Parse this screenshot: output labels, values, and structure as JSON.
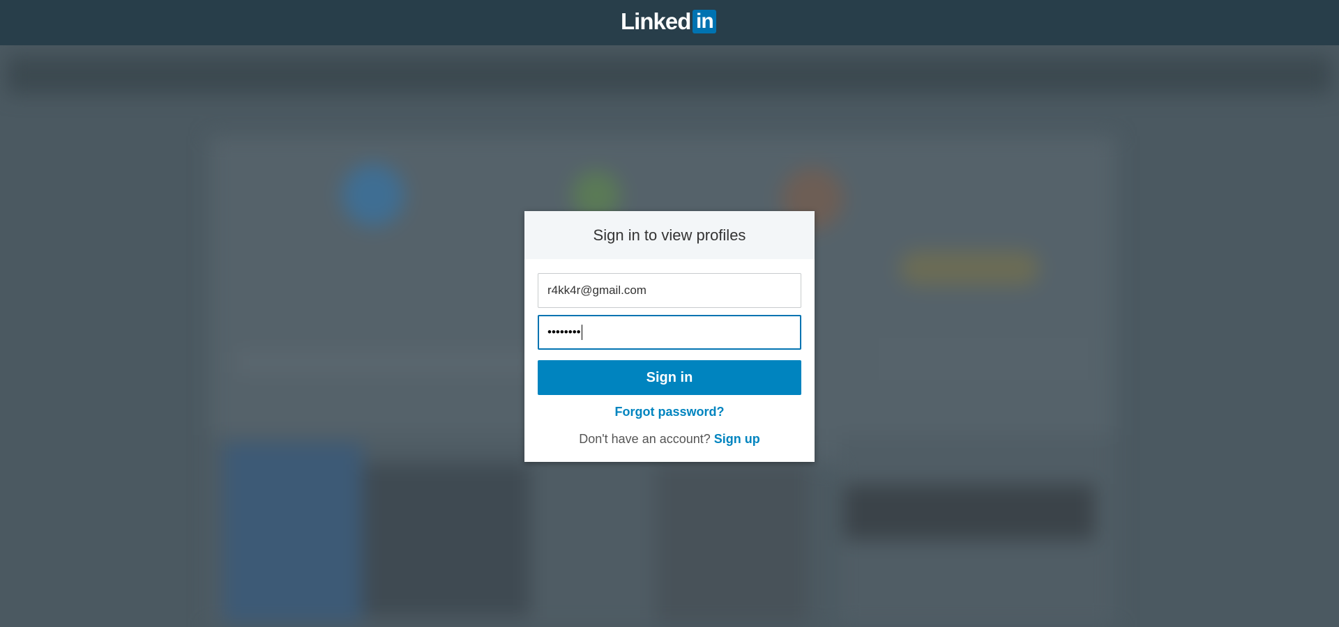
{
  "header": {
    "logo_word": "Linked",
    "logo_box": "in"
  },
  "modal": {
    "title": "Sign in to view profiles",
    "email_value": "r4kk4r@gmail.com",
    "password_value": "••••••••",
    "signin_label": "Sign in",
    "forgot_label": "Forgot password?",
    "no_account_text": "Don't have an account?",
    "signup_label": "Sign up"
  },
  "colors": {
    "header_bg": "#283e4a",
    "brand_blue": "#0073b1",
    "button_blue": "#0084bf",
    "overlay_bg": "#4b5961"
  }
}
